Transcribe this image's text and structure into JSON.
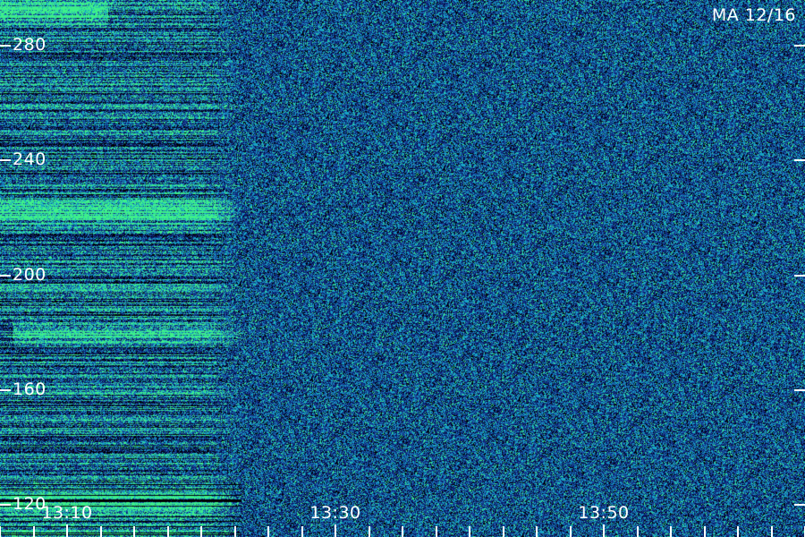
{
  "chart_data": {
    "type": "heatmap",
    "title": "",
    "annotation": "MA 12/16",
    "xlabel": "",
    "ylabel": "",
    "x_ticks": [
      "13:10",
      "13:30",
      "13:50"
    ],
    "x_minor_tick_minutes": 2.5,
    "y_ticks": [
      120,
      160,
      200,
      240,
      280
    ],
    "ylim": [
      115,
      296
    ],
    "xlim_minutes": [
      "13:05",
      "14:05"
    ],
    "y_scale": "linear",
    "y_direction": "increasing-upward",
    "grid": false,
    "colormap": [
      "#000000",
      "#0a1a6a",
      "#1a4a9a",
      "#16a2c8",
      "#3ef08a"
    ],
    "features": [
      {
        "name": "burst-region",
        "time_range": [
          "13:05",
          "13:23"
        ],
        "y_range": [
          115,
          296
        ]
      },
      {
        "name": "bright-band",
        "time_range": [
          "13:05",
          "13:23"
        ],
        "y_value": 222
      },
      {
        "name": "bright-band",
        "time_range": [
          "13:06",
          "13:23"
        ],
        "y_value": 180
      },
      {
        "name": "bright-band",
        "time_range": [
          "13:05",
          "13:23"
        ],
        "y_value": 120
      },
      {
        "name": "bright-band",
        "time_range": [
          "13:05",
          "13:13"
        ],
        "y_value": 292
      }
    ]
  },
  "colors": {
    "background": "#071a3a",
    "text": "#ffffff",
    "tick": "#ffffff"
  }
}
